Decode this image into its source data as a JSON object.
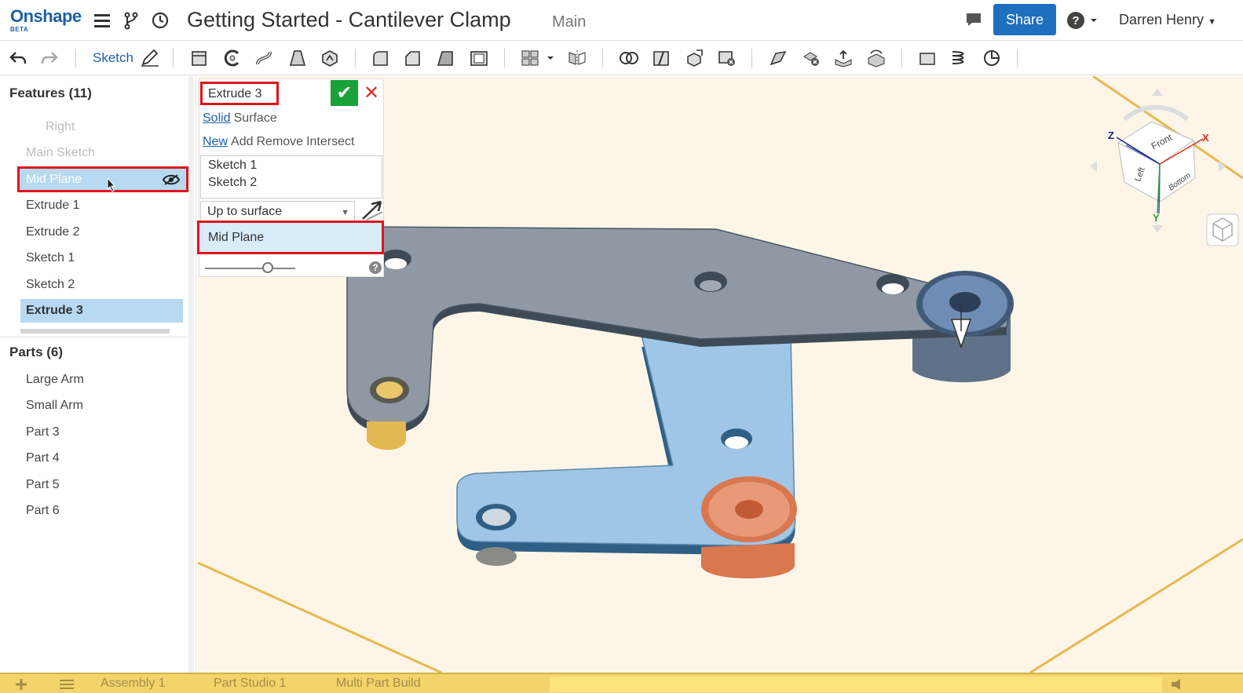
{
  "app": {
    "logo": "Onshape",
    "logo_sub": "BETA",
    "document_title": "Getting Started - Cantilever Clamp",
    "branch": "Main",
    "share_label": "Share",
    "user_name": "Darren Henry"
  },
  "toolbar": {
    "sketch_label": "Sketch"
  },
  "features": {
    "header": "Features (11)",
    "items": [
      {
        "label": "Right",
        "state": "dim"
      },
      {
        "label": "Main Sketch",
        "state": "dim"
      },
      {
        "label": "Mid Plane",
        "state": "hover"
      },
      {
        "label": "Extrude 1",
        "state": "normal"
      },
      {
        "label": "Extrude 2",
        "state": "normal"
      },
      {
        "label": "Sketch 1",
        "state": "normal"
      },
      {
        "label": "Sketch 2",
        "state": "normal"
      },
      {
        "label": "Extrude 3",
        "state": "selected"
      }
    ]
  },
  "parts": {
    "header": "Parts (6)",
    "items": [
      "Large Arm",
      "Small Arm",
      "Part 3",
      "Part 4",
      "Part 5",
      "Part 6"
    ]
  },
  "dialog": {
    "name": "Extrude 3",
    "type_options": [
      "Solid",
      "Surface"
    ],
    "type_active": "Solid",
    "op_options": [
      "New",
      "Add",
      "Remove",
      "Intersect"
    ],
    "op_active": "New",
    "selections": [
      "Sketch 1",
      "Sketch 2"
    ],
    "end_type": "Up to surface",
    "highlighted_option": "Mid Plane",
    "help": "?"
  },
  "view_cube": {
    "faces": [
      "Front",
      "Left",
      "Bottom"
    ],
    "axes": [
      "X",
      "Y",
      "Z"
    ]
  },
  "bottom_tabs": [
    {
      "label": "Assembly 1"
    },
    {
      "label": "Part Studio 1"
    },
    {
      "label": "Multi Part Build"
    }
  ],
  "colors": {
    "brand": "#1f5fa6",
    "highlight_red": "#e0141e",
    "ok_green": "#18a237",
    "selection_blue": "#b7d9f2"
  }
}
